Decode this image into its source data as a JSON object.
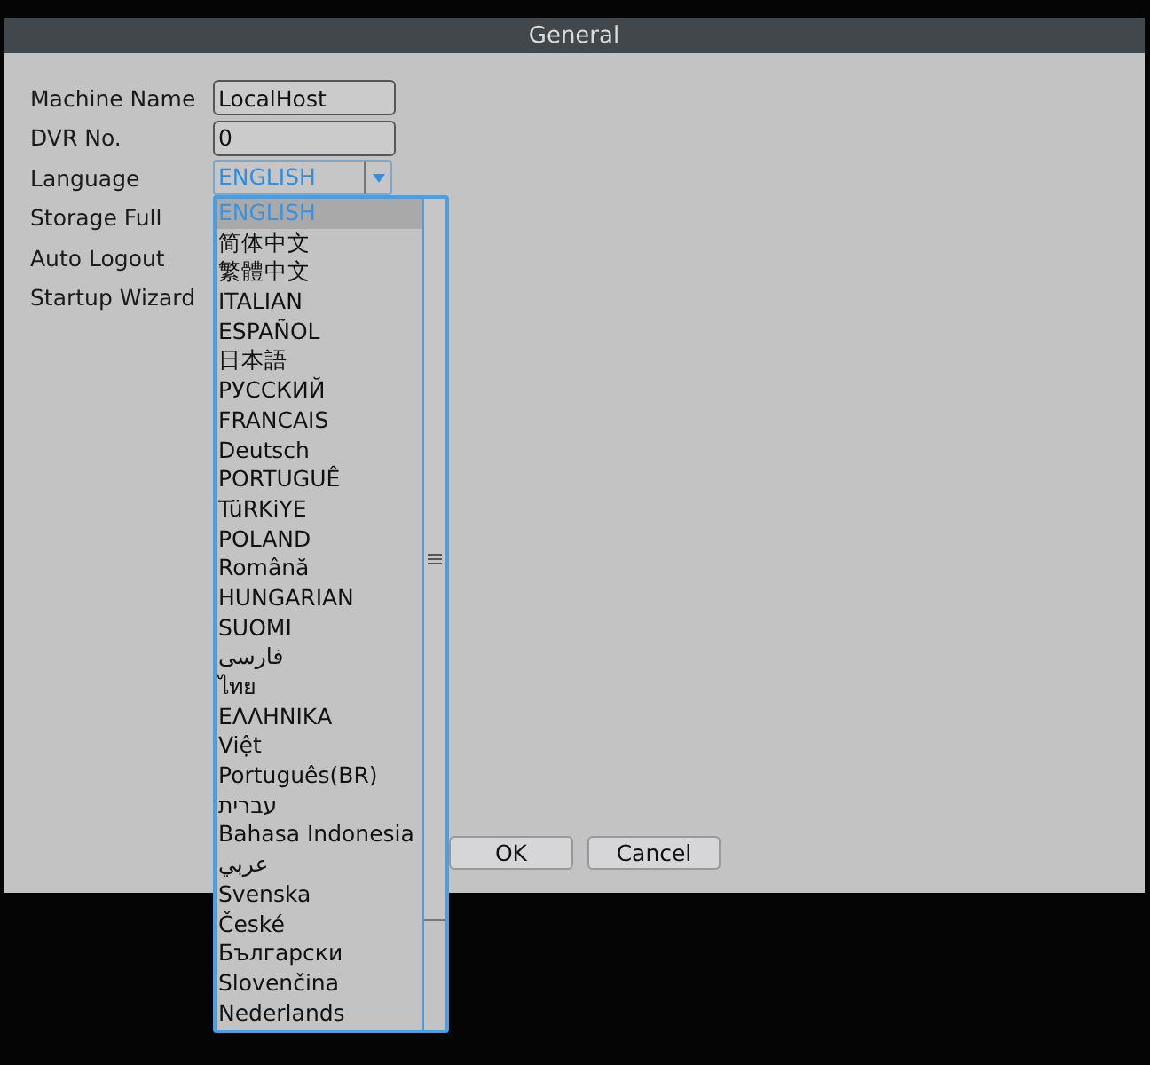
{
  "window": {
    "title": "General"
  },
  "fields": [
    {
      "label": "Machine Name",
      "kind": "text",
      "value": "LocalHost"
    },
    {
      "label": "DVR No.",
      "kind": "text",
      "value": "0"
    },
    {
      "label": "Language",
      "kind": "select",
      "value": "ENGLISH"
    },
    {
      "label": "Storage Full",
      "kind": "covered"
    },
    {
      "label": "Auto Logout",
      "kind": "covered"
    },
    {
      "label": "Startup Wizard",
      "kind": "covered"
    }
  ],
  "language_options": [
    {
      "label": "ENGLISH",
      "selected": true
    },
    {
      "label": "简体中文",
      "selected": false
    },
    {
      "label": "繁體中文",
      "selected": false
    },
    {
      "label": "ITALIAN",
      "selected": false
    },
    {
      "label": "ESPAÑOL",
      "selected": false
    },
    {
      "label": "日本語",
      "selected": false
    },
    {
      "label": "РУССКИЙ",
      "selected": false
    },
    {
      "label": "FRANCAIS",
      "selected": false
    },
    {
      "label": "Deutsch",
      "selected": false
    },
    {
      "label": "PORTUGUÊ",
      "selected": false
    },
    {
      "label": "TüRKiYE",
      "selected": false
    },
    {
      "label": "POLAND",
      "selected": false
    },
    {
      "label": "Română",
      "selected": false
    },
    {
      "label": "HUNGARIAN",
      "selected": false
    },
    {
      "label": "SUOMI",
      "selected": false
    },
    {
      "label": "فارسی",
      "selected": false
    },
    {
      "label": "ไทย",
      "selected": false
    },
    {
      "label": "ΕΛΛΗΝΙΚΑ",
      "selected": false
    },
    {
      "label": "Việt",
      "selected": false
    },
    {
      "label": "Português(BR)",
      "selected": false
    },
    {
      "label": "עברית",
      "selected": false
    },
    {
      "label": "Bahasa Indonesia",
      "selected": false
    },
    {
      "label": "عربي",
      "selected": false
    },
    {
      "label": "Svenska",
      "selected": false
    },
    {
      "label": "České",
      "selected": false
    },
    {
      "label": "Български",
      "selected": false
    },
    {
      "label": "Slovenčina",
      "selected": false
    },
    {
      "label": "Nederlands",
      "selected": false
    }
  ],
  "buttons": [
    "OK",
    "Cancel"
  ]
}
